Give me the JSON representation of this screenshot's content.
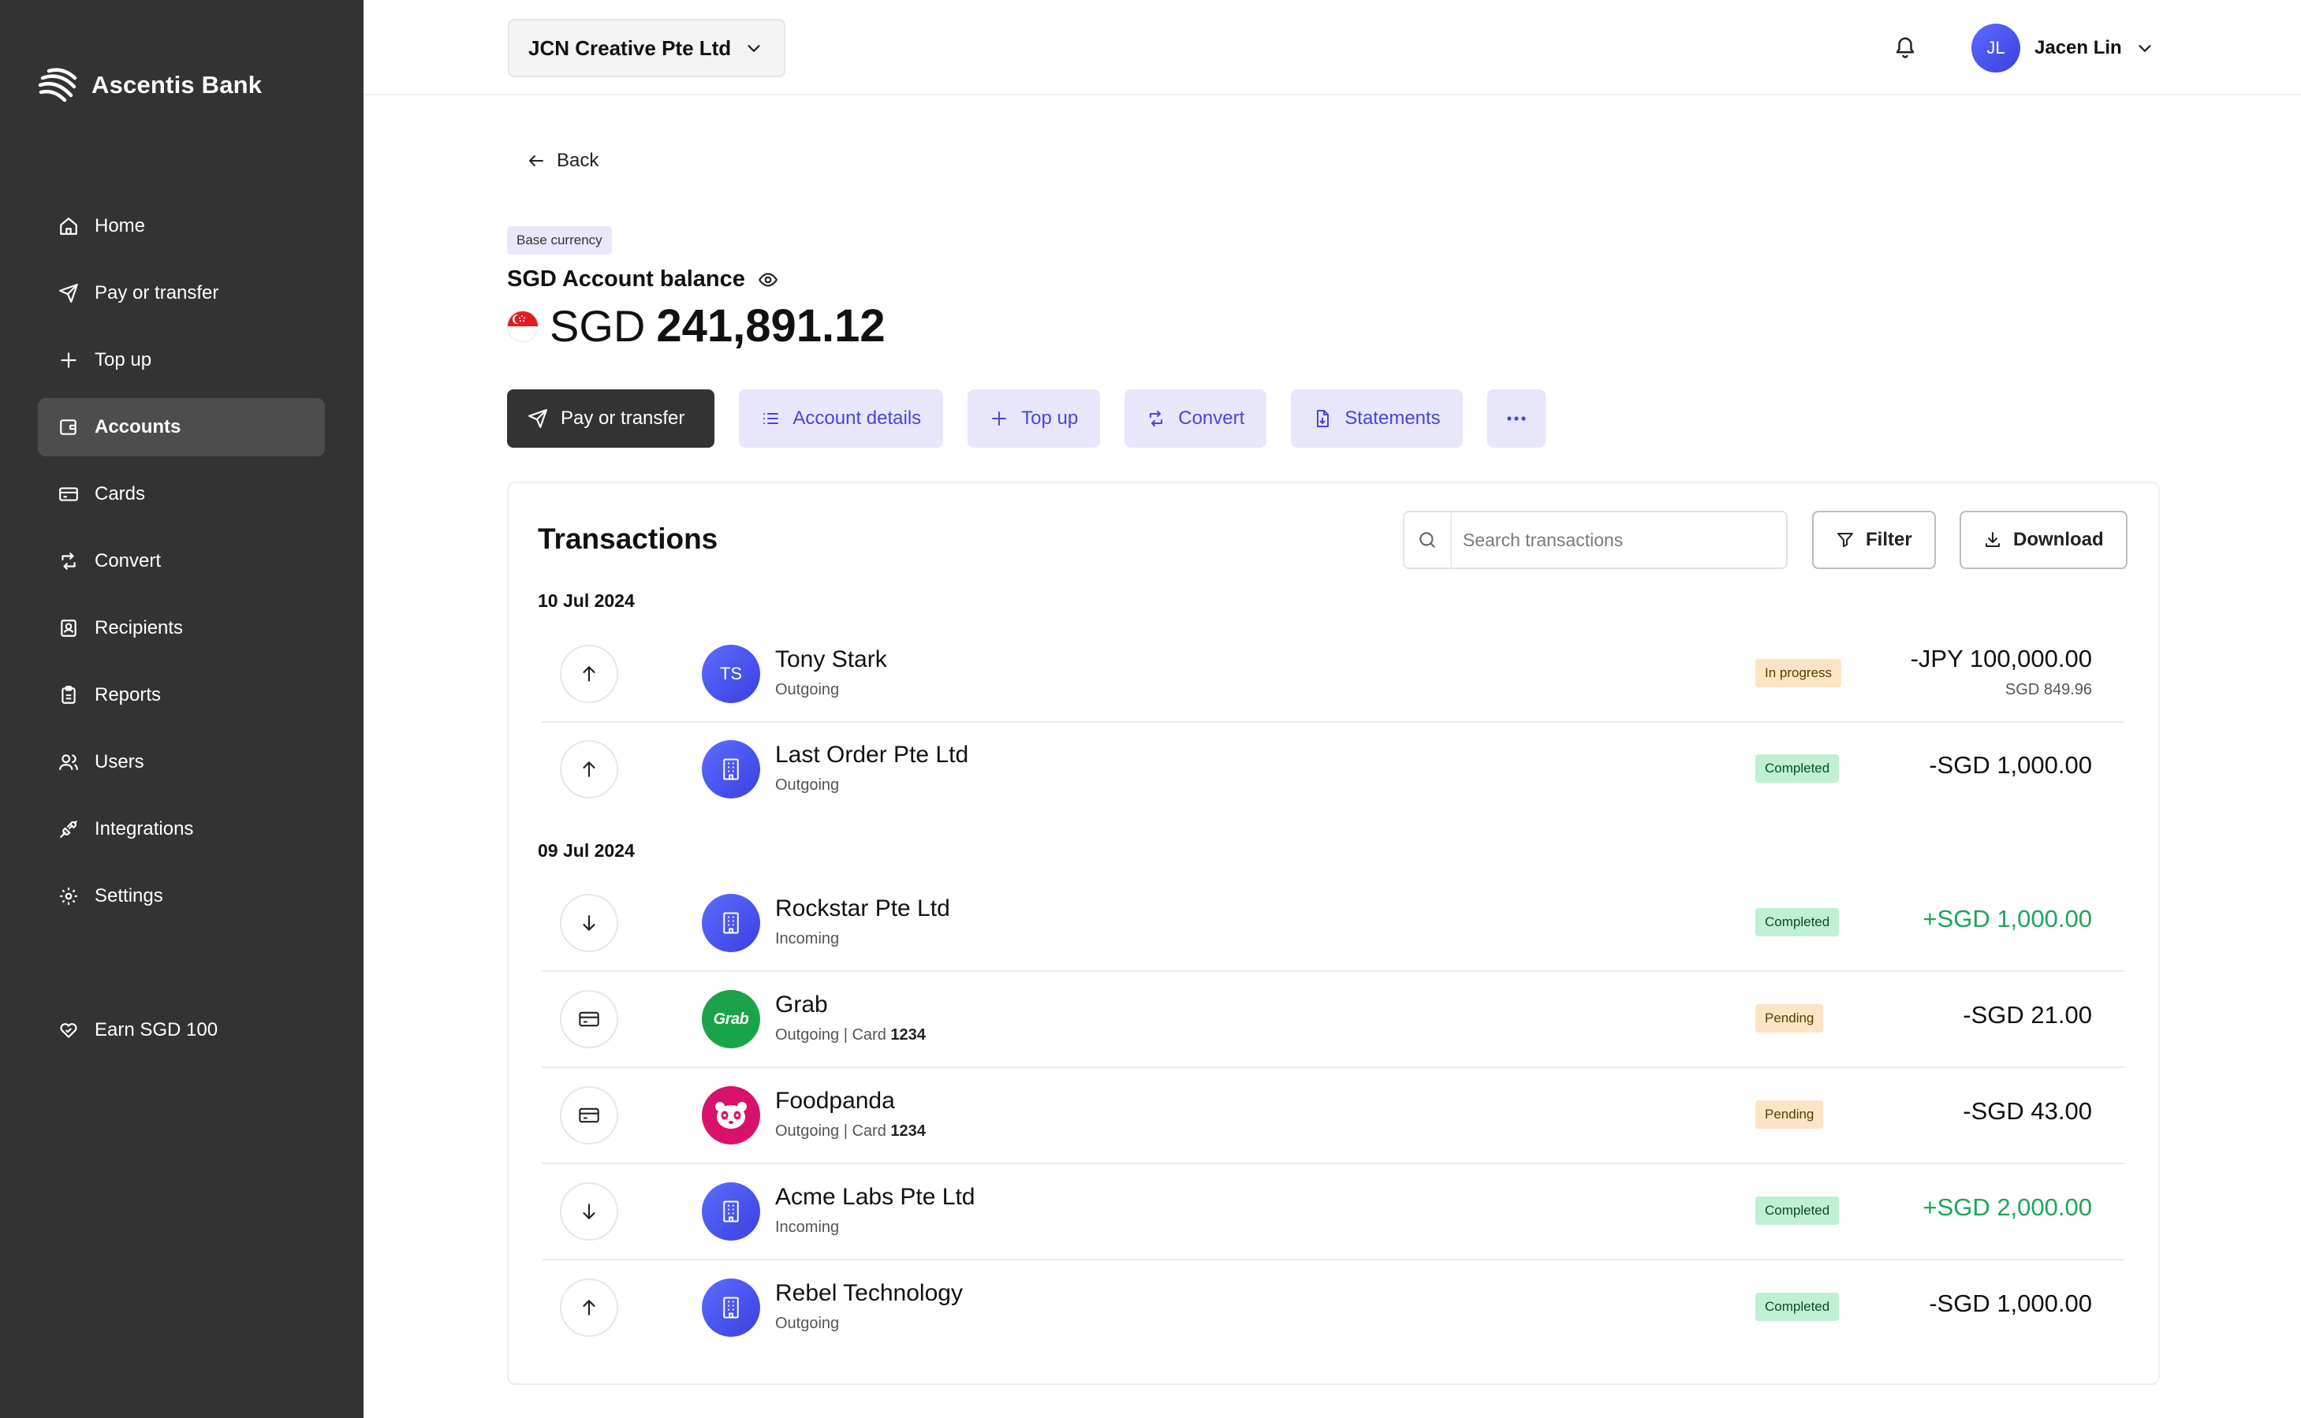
{
  "sidebar": {
    "brand": "Ascentis Bank",
    "items": [
      {
        "label": "Home",
        "icon": "home-icon"
      },
      {
        "label": "Pay or transfer",
        "icon": "send-icon"
      },
      {
        "label": "Top up",
        "icon": "plus-icon"
      },
      {
        "label": "Accounts",
        "icon": "wallet-icon",
        "active": true
      },
      {
        "label": "Cards",
        "icon": "card-icon"
      },
      {
        "label": "Convert",
        "icon": "convert-icon"
      },
      {
        "label": "Recipients",
        "icon": "recipients-icon"
      },
      {
        "label": "Reports",
        "icon": "clipboard-icon"
      },
      {
        "label": "Users",
        "icon": "users-icon"
      },
      {
        "label": "Integrations",
        "icon": "plug-icon"
      },
      {
        "label": "Settings",
        "icon": "gear-icon"
      }
    ],
    "promo": {
      "label": "Earn SGD 100",
      "icon": "heart-hand-icon"
    }
  },
  "topbar": {
    "company": "JCN Creative Pte Ltd",
    "user": {
      "initials": "JL",
      "name": "Jacen Lin"
    }
  },
  "account": {
    "back_label": "Back",
    "base_badge": "Base currency",
    "balance_label": "SGD Account balance",
    "currency": "SGD",
    "balance": "241,891.12"
  },
  "actions": {
    "pay": "Pay or transfer",
    "details": "Account details",
    "topup": "Top up",
    "convert": "Convert",
    "statements": "Statements"
  },
  "transactions": {
    "title": "Transactions",
    "search_placeholder": "Search transactions",
    "filter_label": "Filter",
    "download_label": "Download",
    "groups": [
      {
        "date": "10 Jul 2024",
        "rows": [
          {
            "name": "Tony Stark",
            "sub": "Outgoing",
            "status": "In progress",
            "amount": "-JPY 100,000.00",
            "amount_sub": "SGD 849.96",
            "avatar": "TS"
          },
          {
            "name": "Last Order Pte Ltd",
            "sub": "Outgoing",
            "status": "Completed",
            "amount": "-SGD 1,000.00"
          }
        ]
      },
      {
        "date": "09 Jul 2024",
        "rows": [
          {
            "name": "Rockstar Pte Ltd",
            "sub": "Incoming",
            "status": "Completed",
            "amount": "+SGD 1,000.00"
          },
          {
            "name": "Grab",
            "sub": "Outgoing | Card ",
            "card": "1234",
            "status": "Pending",
            "amount": "-SGD 21.00",
            "avatar": "Grab"
          },
          {
            "name": "Foodpanda",
            "sub": "Outgoing | Card ",
            "card": "1234",
            "status": "Pending",
            "amount": "-SGD 43.00"
          },
          {
            "name": "Acme Labs Pte Ltd",
            "sub": "Incoming",
            "status": "Completed",
            "amount": "+SGD 2,000.00"
          },
          {
            "name": "Rebel Technology",
            "sub": "Outgoing",
            "status": "Completed",
            "amount": "-SGD 1,000.00"
          }
        ]
      }
    ]
  },
  "colors": {
    "sidebar": "#333333",
    "accent": "#4b46d8",
    "incoming": "#1ea55a"
  }
}
